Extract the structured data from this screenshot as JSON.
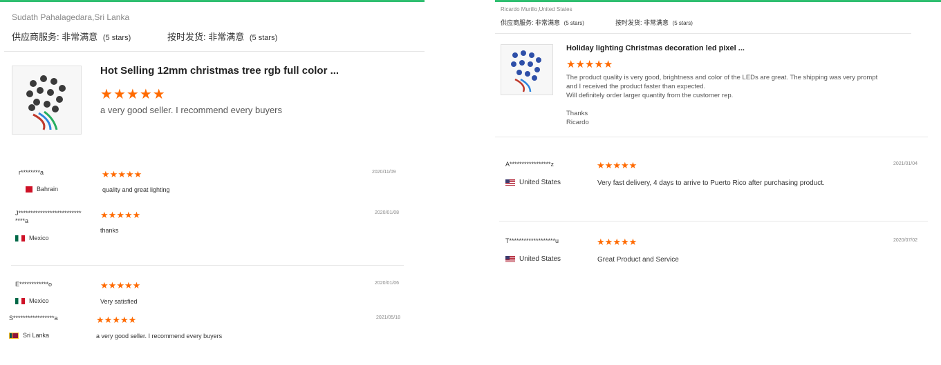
{
  "left": {
    "seller_location": "Sudath Pahalagedara,Sri Lanka",
    "supplier_service_label": "供应商服务:",
    "supplier_service_value": "非常满意",
    "supplier_service_stars": "(5 stars)",
    "shipping_label": "按时发货:",
    "shipping_value": "非常满意",
    "shipping_stars": "(5 stars)",
    "product_title": "Hot Selling 12mm christmas tree rgb full color ...",
    "product_rating": 5,
    "product_comment": "a very good seller. I  recommend every buyers",
    "reviews": [
      {
        "name": "r********a",
        "country": "Bahrain",
        "date": "2020/11/09",
        "comment": "quality and great lighting",
        "rating": 5
      },
      {
        "name": "J**************************",
        "name2": "****a",
        "country": "Mexico",
        "date": "2020/01/08",
        "comment": "thanks",
        "rating": 5
      },
      {
        "name": "E************o",
        "country": "Mexico",
        "date": "2020/01/06",
        "comment": "Very satisfied",
        "rating": 5
      },
      {
        "name": "S*****************a",
        "country": "Sri Lanka",
        "date": "2021/05/18",
        "comment": "a very good seller. I recommend every buyers",
        "rating": 5
      }
    ]
  },
  "right": {
    "reviewer_location": "Ricardo Murillo,United States",
    "supplier_service_label": "供应商服务:",
    "supplier_service_value": "非常满意",
    "supplier_service_stars": "(5 stars)",
    "shipping_label": "按时发货:",
    "shipping_value": "非常满意",
    "shipping_stars": "(5 stars)",
    "product_title": "Holiday lighting Christmas decoration led pixel ...",
    "product_rating": 5,
    "product_comment_line1": "The product quality is very good, brightness and color of the LEDs are great. The shipping was very prompt",
    "product_comment_line2": "and I received the product faster than expected.",
    "product_comment_line3": "Will definitely order larger quantity from the customer rep.",
    "product_comment_line4": "Thanks",
    "product_comment_line5": "Ricardo",
    "reviews": [
      {
        "name": "A*****************z",
        "country": "United States",
        "date": "2021/01/04",
        "comment": "Very fast delivery, 4 days to arrive to Puerto Rico after purchasing product.",
        "rating": 5
      },
      {
        "name": "T*******************u",
        "country": "United States",
        "date": "2020/07/02",
        "comment": "Great Product and Service",
        "rating": 5
      }
    ]
  },
  "colors": {
    "star": "#ff6a00",
    "accent_line": "#2fbf71"
  },
  "icons": {
    "star": "star-icon",
    "flags": [
      "flag-bahrain-icon",
      "flag-mexico-icon",
      "flag-sri-lanka-icon",
      "flag-united-states-icon"
    ]
  }
}
